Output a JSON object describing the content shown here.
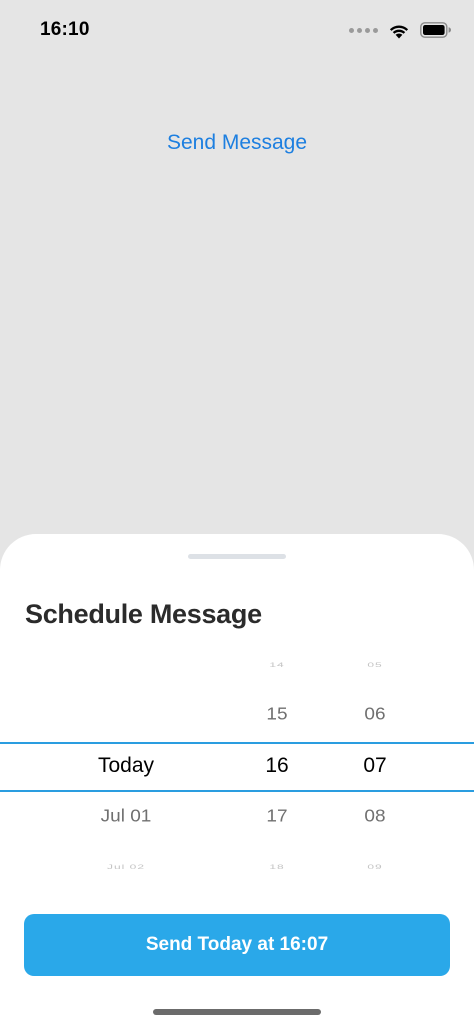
{
  "status_bar": {
    "time": "16:10",
    "icons": [
      "signal-dots-icon",
      "wifi-icon",
      "battery-icon"
    ]
  },
  "background": {
    "send_message_label": "Send Message",
    "link_color": "#1d7fe0"
  },
  "sheet": {
    "title": "Schedule Message",
    "picker": {
      "date_column": {
        "far_above": "",
        "above": "",
        "selected": "Today",
        "below": "Jul 01",
        "far_below": "Jul 02"
      },
      "hour_column": {
        "far_above": "14",
        "above": "15",
        "selected": "16",
        "below": "17",
        "far_below": "18"
      },
      "minute_column": {
        "far_above": "05",
        "above": "06",
        "selected": "07",
        "below": "08",
        "far_below": "09"
      },
      "selection_line_color": "#2a9de0"
    },
    "send_button_label": "Send Today at 16:07",
    "button_color": "#2aa8e9"
  }
}
